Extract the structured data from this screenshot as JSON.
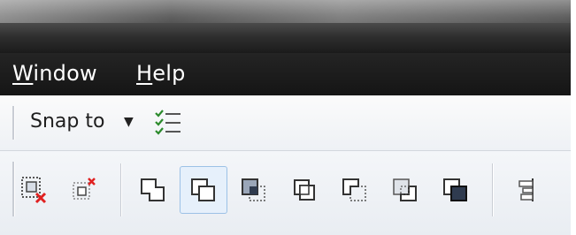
{
  "menubar": {
    "items": [
      {
        "mnemonic": "W",
        "rest": "indow"
      },
      {
        "mnemonic": "H",
        "rest": "elp"
      }
    ]
  },
  "snap_toolbar": {
    "snap_label": "Snap to",
    "dropdown_icon": "triangle-down",
    "snap_options_icon": "checklist-icon"
  },
  "shape_toolbar": {
    "buttons": [
      {
        "icon": "delete-virtual-segment-icon"
      },
      {
        "icon": "delete-node-icon"
      },
      {
        "icon": "weld-icon"
      },
      {
        "icon": "trim-icon",
        "selected": true
      },
      {
        "icon": "intersect-icon"
      },
      {
        "icon": "simplify-icon"
      },
      {
        "icon": "front-minus-back-icon"
      },
      {
        "icon": "back-minus-front-icon"
      },
      {
        "icon": "create-boundary-icon"
      },
      {
        "icon": "bring-to-front-icon"
      },
      {
        "icon": "align-distribute-icon"
      }
    ]
  },
  "colors": {
    "menubar_bg": "#1b1b1b",
    "toolbar_bg": "#eef1f5",
    "selection": "#e6f0fb",
    "delete_red": "#e02020"
  }
}
